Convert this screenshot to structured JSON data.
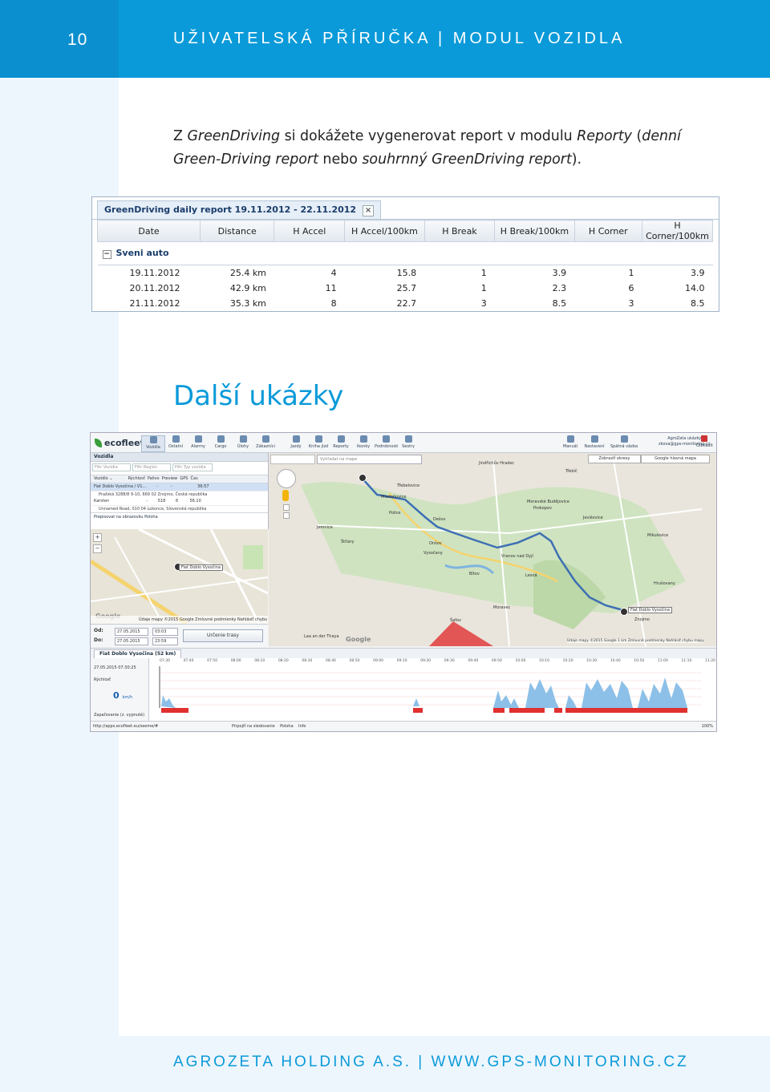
{
  "header": {
    "page_number": "10",
    "title": "UŽIVATELSKÁ PŘÍRUČKA | MODUL VOZIDLA"
  },
  "intro": {
    "t1": "Z ",
    "t2": "GreenDriving",
    "t3": " si dokážete vygenerovat report v modulu ",
    "t4": "Reporty",
    "t5": " (",
    "t6": "denní Green-Driving report",
    "t7": " nebo ",
    "t8": "souhrnný GreenDriving report",
    "t9": ")."
  },
  "report": {
    "tab_title": "GreenDriving daily report 19.11.2012 - 22.11.2012",
    "close": "×",
    "columns": [
      "Date",
      "Distance",
      "H Accel",
      "H Accel/100km",
      "H Break",
      "H Break/100km",
      "H Corner",
      "H Corner/100km"
    ],
    "group": "Sveni auto",
    "rows": [
      [
        "19.11.2012",
        "25.4 km",
        "4",
        "15.8",
        "1",
        "3.9",
        "1",
        "3.9"
      ],
      [
        "20.11.2012",
        "42.9 km",
        "11",
        "25.7",
        "1",
        "2.3",
        "6",
        "14.0"
      ],
      [
        "21.11.2012",
        "35.3 km",
        "8",
        "22.7",
        "3",
        "8.5",
        "3",
        "8.5"
      ]
    ]
  },
  "section_title": "Další ukázky",
  "screenshot": {
    "logo": "ecofleet",
    "toolbar": [
      "Vozidla",
      "Ostatní",
      "Alarmy",
      "Cargo",
      "Úlohy",
      "Zákazníci",
      "Jazdy",
      "Kniha jízd",
      "Reporty",
      "Ikonky",
      "Podrobnosti",
      "Sestry"
    ],
    "toolbar_right": [
      "Manuál",
      "Nastavení",
      "Spätná väzba"
    ],
    "user": {
      "title": "AgroZeta ukázky",
      "email": "zkova@gps-monitoring.cz"
    },
    "logout": "Odhlásit",
    "panel_title": "Vozidla",
    "filters": [
      "Filtr Vozidla",
      "Filtr Región",
      "Filtr Typ vozidla"
    ],
    "col_header": "Vozidlo ⌄            Rýchlosť  Palivo  Preview  GPS  Čas",
    "vehicles": [
      {
        "row": "Fiat Doblo Vysočina / V1...        -          -                    36:57",
        "addr": "Pražská 3288/8 9-10, 669 02 Znojmo, Česká republika"
      },
      {
        "row": "Karsten                             -        518        6         56.10",
        "addr": "Unnamed Road, 010 04 Lokonce, Slovenská republika"
      }
    ],
    "bottom_link": "Prepisovat na obrazovku  Poloha",
    "minimap_label": "Fiat Doblo Vysočina",
    "minimap_bar": "Údaje mapy ©2015 Google  Zmluvné podmienky  Nahlásiť chybu mapy",
    "google": "Google",
    "od_label": "Od:",
    "do_label": "Do:",
    "od_date": "27.05.2015",
    "od_time": "03:03",
    "do_date": "27.05.2015",
    "do_time": "23:59",
    "route_button": "Určenie trasy",
    "map_search": "Vyhľadat na mape",
    "map_type": "Zobraziť okresy",
    "map_type2": "Google hlavná mapa",
    "towns": [
      "Jindřichův Hradec",
      "Třebelovice",
      "Mladoňovice",
      "Moravské Budějovice",
      "Dešov",
      "Vysočany",
      "Vranov nad Dyjí",
      "Znojmo",
      "Mikulovice",
      "Jevišovice",
      "Hrušovany",
      "Šafov",
      "Moravec",
      "Lesná",
      "Bítov",
      "Jemnice",
      "Štítary",
      "Police",
      "Prokopov",
      "Třebíč",
      "Onšov",
      "Laa an der Thaya"
    ],
    "map_label": "Fiat Doblo Vysočina",
    "map_footer": "Údaje mapy ©2015 Google  1 km  Zmluvné podmienky  Nahlásiť chybu mapy",
    "track_tab": "Fiat Doblo Vysočina (52 km)",
    "tl_date": "27.05.2015 07:30:25",
    "tl_speed_label": "Rýchlosť",
    "tl_speed": "0",
    "tl_unit": "km/h",
    "tl_ignition": "Zapaľovanie (z. vypnuté)",
    "tl_ticks": [
      "07:30",
      "07:40",
      "07:50",
      "08:00",
      "08:10",
      "08:20",
      "08:30",
      "08:40",
      "08:50",
      "09:00",
      "09:10",
      "09:20",
      "09:30",
      "09:40",
      "09:50",
      "10:00",
      "10:10",
      "10:20",
      "10:30",
      "10:40",
      "10:50",
      "11:00",
      "11:10",
      "11:20"
    ],
    "status_url": "http://apps.ecofleet.eu/seeme/#",
    "status_items": "Pripojiť na sledovanie    Poloha    Info",
    "status_zoom": "100%"
  },
  "footer": "AGROZETA HOLDING A.S. | WWW.GPS-MONITORING.CZ"
}
